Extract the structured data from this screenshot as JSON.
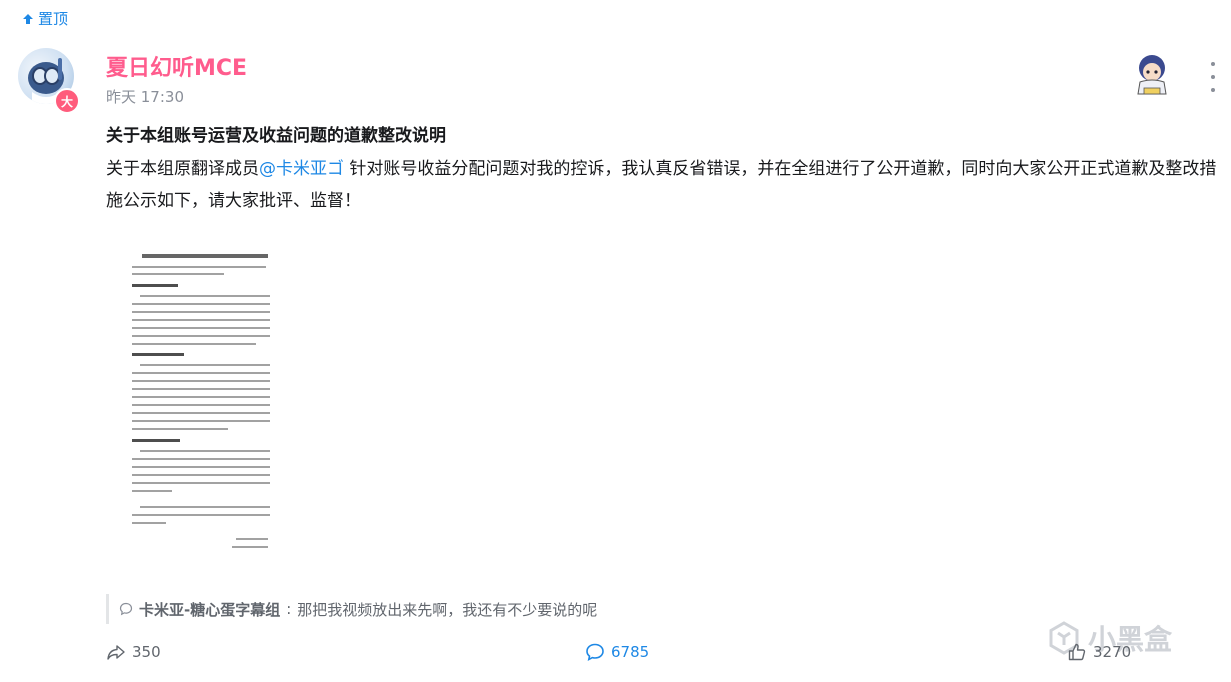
{
  "pin": {
    "label": "置顶"
  },
  "post": {
    "username": "夏日幻听MCE",
    "time": "昨天 17:30",
    "badge": "大",
    "title": "关于本组账号运营及收益问题的道歉整改说明",
    "body_prefix": "关于本组原翻译成员",
    "mention": "@卡米亚ゴ",
    "body_suffix": " 针对账号收益分配问题对我的控诉，我认真反省错误，并在全组进行了公开道歉，同时向大家公开正式道歉及整改措施公示如下，请大家批评、监督！"
  },
  "comment": {
    "author": "卡米亚-糖心蛋字幕组",
    "separator": ":",
    "text": "那把我视频放出来先啊，我还有不少要说的呢"
  },
  "actions": {
    "share_count": "350",
    "reply_count": "6785",
    "like_count": "3270"
  },
  "watermark": {
    "text": "小黑盒"
  },
  "colors": {
    "accent": "#1e88e5",
    "username": "#ff5c8d",
    "muted": "#8a8f99"
  }
}
